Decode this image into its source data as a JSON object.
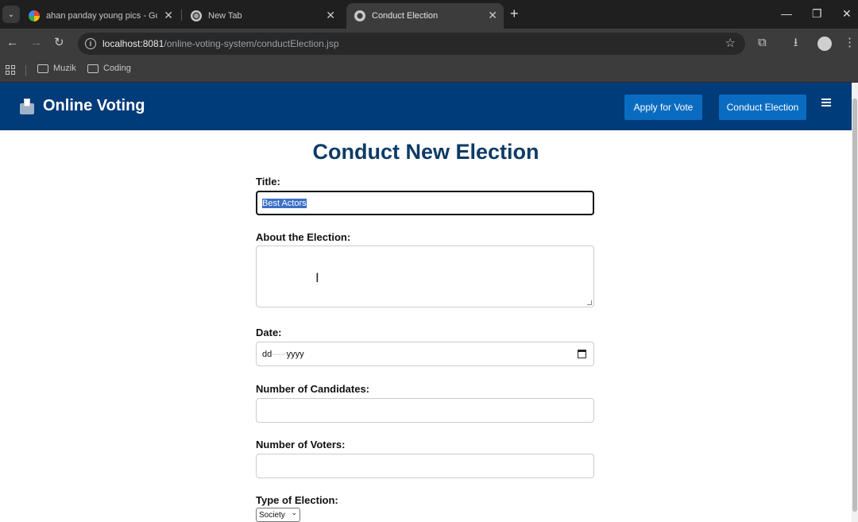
{
  "browser": {
    "tabs": [
      {
        "title": "ahan panday young pics - Goo",
        "active": false
      },
      {
        "title": "New Tab",
        "active": false
      },
      {
        "title": "Conduct Election",
        "active": true
      }
    ],
    "url_host": "localhost:8081",
    "url_path": "/online-voting-system/conductElection.jsp",
    "bookmarks": [
      "Muzik",
      "Coding"
    ]
  },
  "navbar": {
    "brand": "Online Voting",
    "apply_label": "Apply for Vote",
    "conduct_label": "Conduct Election",
    "bg_color": "#003b7a",
    "button_color": "#0a6cc0"
  },
  "form": {
    "heading": "Conduct New Election",
    "title_label": "Title:",
    "title_value": "Best Actors",
    "about_label": "About the Election:",
    "about_value": "",
    "date_label": "Date:",
    "date_placeholder_dd": "dd",
    "date_placeholder_sep1": "-----",
    "date_placeholder_yyyy": "yyyy",
    "candidates_label": "Number of Candidates:",
    "candidates_value": "",
    "voters_label": "Number of Voters:",
    "voters_value": "",
    "type_label": "Type of Election:",
    "type_value": "Society"
  }
}
